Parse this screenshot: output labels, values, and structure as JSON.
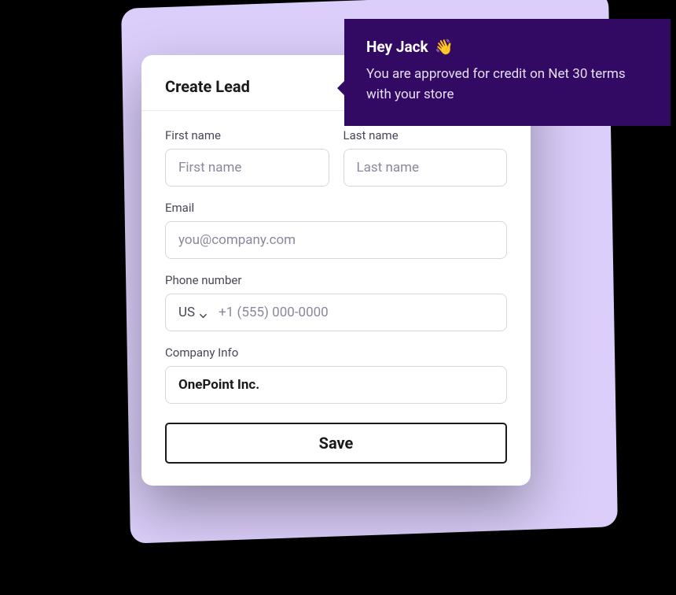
{
  "card": {
    "title": "Create Lead"
  },
  "notification": {
    "greeting": "Hey Jack",
    "emoji": "👋",
    "body": "You are approved for credit on Net 30 terms with your store"
  },
  "form": {
    "first_name": {
      "label": "First name",
      "placeholder": "First name",
      "value": ""
    },
    "last_name": {
      "label": "Last name",
      "placeholder": "Last name",
      "value": ""
    },
    "email": {
      "label": "Email",
      "placeholder": "you@company.com",
      "value": ""
    },
    "phone": {
      "label": "Phone number",
      "country": "US",
      "placeholder": "+1 (555) 000-0000",
      "value": ""
    },
    "company": {
      "label": "Company Info",
      "value": "OnePoint Inc."
    },
    "save_label": "Save"
  }
}
